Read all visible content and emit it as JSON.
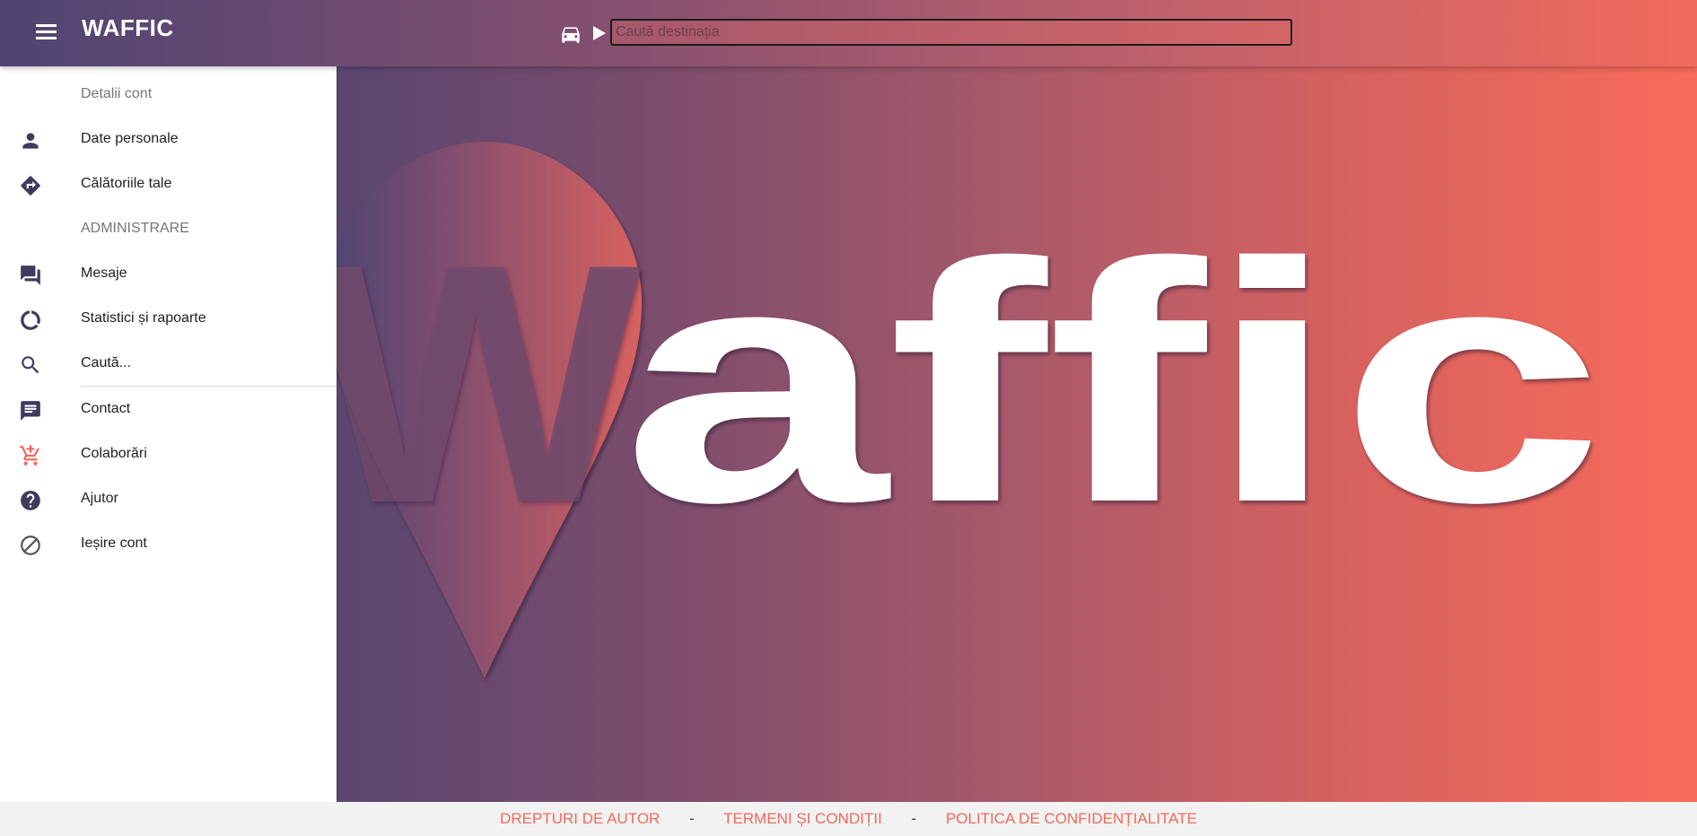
{
  "header": {
    "app_title": "WAFFIC",
    "menu_icon": "menu-icon",
    "car_icon": "car-icon",
    "play_icon": "play-icon",
    "search": {
      "placeholder": "Caută destinația",
      "value": ""
    }
  },
  "hero": {
    "logo_text": "Waffic",
    "logo_letters_rest": "affic",
    "logo_first_letter": "W",
    "pin_icon": "location-pin-icon"
  },
  "sidebar": {
    "sections": [
      {
        "header": "Detalii cont",
        "items": [
          {
            "label": "Date personale",
            "icon": "person-icon"
          },
          {
            "label": "Călătoriile tale",
            "icon": "directions-icon"
          }
        ]
      },
      {
        "header": "ADMINISTRARE",
        "items": [
          {
            "label": "Mesaje",
            "icon": "forum-icon"
          },
          {
            "label": "Statistici și rapoarte",
            "icon": "donut-chart-icon"
          },
          {
            "label": "Caută...",
            "icon": "search-icon"
          }
        ]
      },
      {
        "header": "",
        "items": [
          {
            "label": "Contact",
            "icon": "chat-icon"
          },
          {
            "label": "Colaborări",
            "icon": "add-cart-icon"
          },
          {
            "label": "Ajutor",
            "icon": "help-icon"
          },
          {
            "label": "Ieșire cont",
            "icon": "block-icon"
          }
        ]
      }
    ]
  },
  "footer": {
    "links": [
      "DREPTURI DE AUTOR",
      "TERMENI ȘI CONDIȚII",
      "POLITICA DE CONFIDENȚIALITATE"
    ],
    "separator": "-"
  },
  "colors": {
    "primary": "#4f4472",
    "accent": "#f26a5c",
    "icon_dark": "#3f3a5e",
    "icon_accent": "#ef6a5a"
  }
}
